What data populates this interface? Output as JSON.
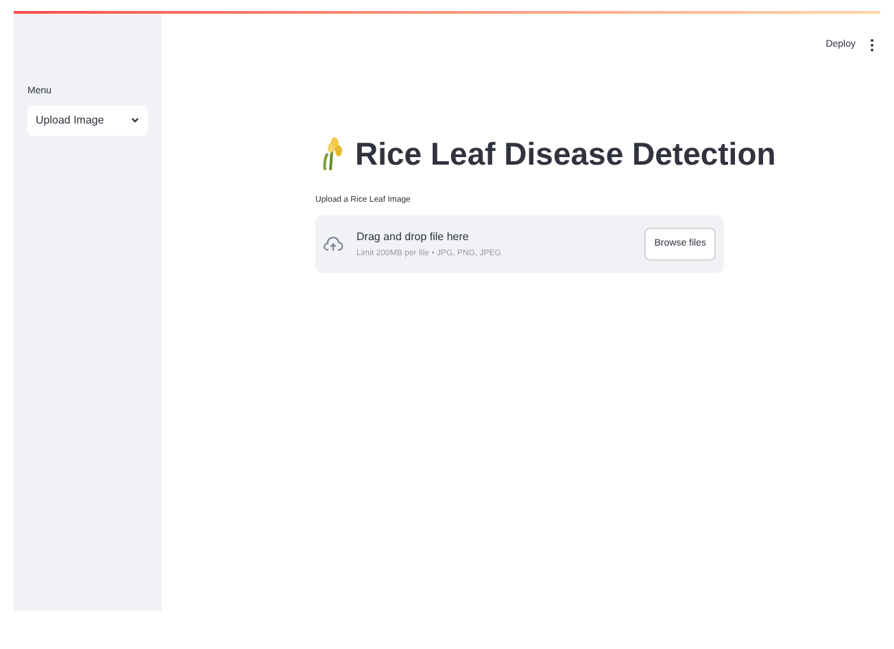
{
  "header": {
    "deploy": "Deploy"
  },
  "sidebar": {
    "label": "Menu",
    "select": {
      "value": "Upload Image"
    }
  },
  "main": {
    "title": "Rice Leaf Disease Detection",
    "uploader": {
      "label": "Upload a Rice Leaf Image",
      "instruction": "Drag and drop file here",
      "limit": "Limit 200MB per file • JPG, PNG, JPEG",
      "button": "Browse files"
    }
  }
}
